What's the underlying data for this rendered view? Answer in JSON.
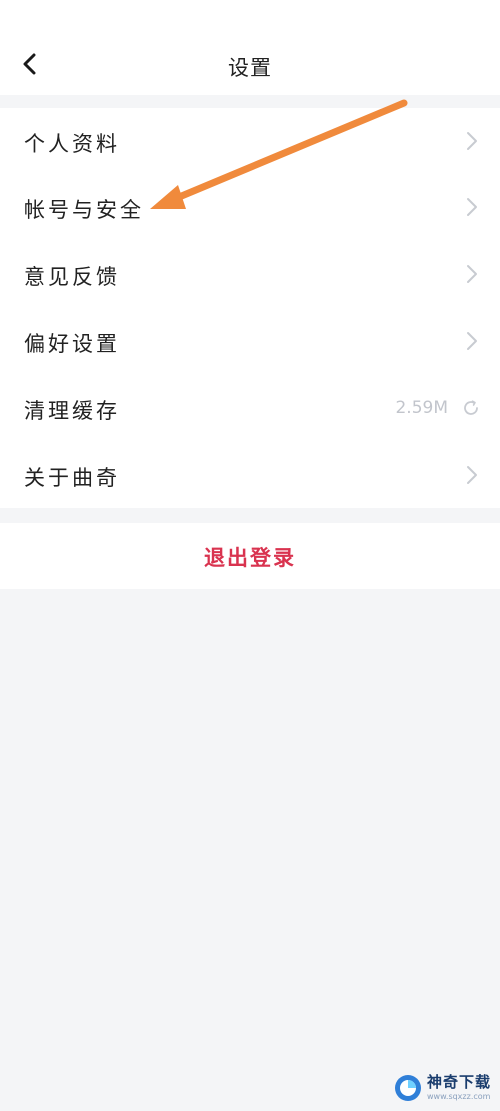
{
  "header": {
    "title": "设置",
    "back_icon": "chevron-left-icon"
  },
  "menu": {
    "items": [
      {
        "label": "个人资料",
        "trailing": "chevron-right-icon"
      },
      {
        "label": "帐号与安全",
        "trailing": "chevron-right-icon"
      },
      {
        "label": "意见反馈",
        "trailing": "chevron-right-icon"
      },
      {
        "label": "偏好设置",
        "trailing": "chevron-right-icon"
      },
      {
        "label": "清理缓存",
        "value": "2.59M",
        "trailing": "refresh-icon"
      },
      {
        "label": "关于曲奇",
        "trailing": "chevron-right-icon"
      }
    ]
  },
  "logout": {
    "label": "退出登录"
  },
  "annotation": {
    "type": "orange-arrow",
    "points_to": "帐号与安全"
  },
  "watermark": {
    "title": "神奇下载",
    "url": "www.sqxzz.com"
  },
  "colors": {
    "background": "#f4f5f7",
    "card": "#ffffff",
    "text": "#222222",
    "chevron": "#c8cbd1",
    "value_text": "#c2c5cc",
    "logout": "#d9334f",
    "arrow": "#f08a3c"
  }
}
